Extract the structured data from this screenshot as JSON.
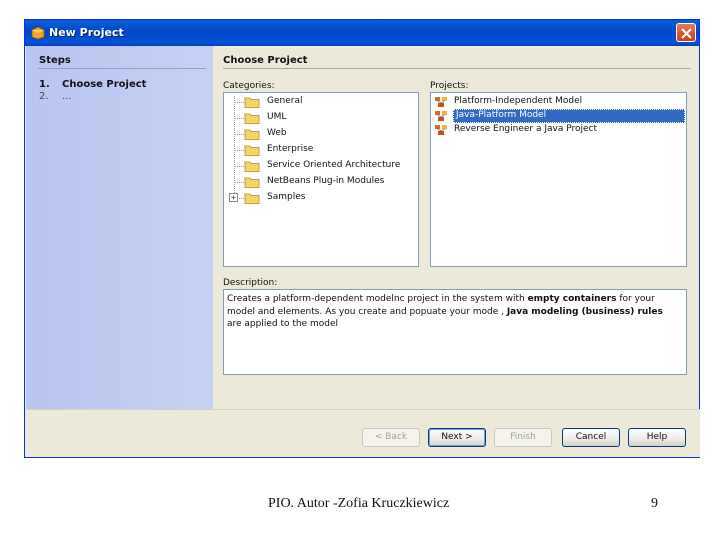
{
  "window": {
    "title": "New Project"
  },
  "steps": {
    "title": "Steps",
    "items": [
      {
        "num": "1.",
        "label": "Choose Project"
      },
      {
        "num": "2.",
        "label": "..."
      }
    ]
  },
  "panel": {
    "title": "Choose Project",
    "categories_label": "Categories:",
    "projects_label": "Projects:",
    "description_label": "Description:"
  },
  "categories": [
    "General",
    "UML",
    "Web",
    "Enterprise",
    "Service Oriented Architecture",
    "NetBeans Plug-in Modules",
    "Samples"
  ],
  "projects": [
    "Platform-Independent Model",
    "Java-Platform Model",
    "Reverse Engineer a Java Project"
  ],
  "selected_project": "Java-Platform Model",
  "description": {
    "p1": "Creates a platform-dependent modelnc project in the system with ",
    "b1": "empty containers",
    "p2": " for your model and elements. As you create and popuate your mode , ",
    "b2": "Java modeling (business) rules",
    "p3": " are applied to the model"
  },
  "buttons": {
    "back": "< Back",
    "next": "Next >",
    "finish": "Finish",
    "cancel": "Cancel",
    "help": "Help"
  },
  "footer": {
    "text": "PIO.  Autor -Zofia Kruczkiewicz",
    "page": "9"
  },
  "colors": {
    "titlebar": "#0047c8",
    "selection": "#316ac5",
    "steps_bg": "#c5d1f4"
  }
}
